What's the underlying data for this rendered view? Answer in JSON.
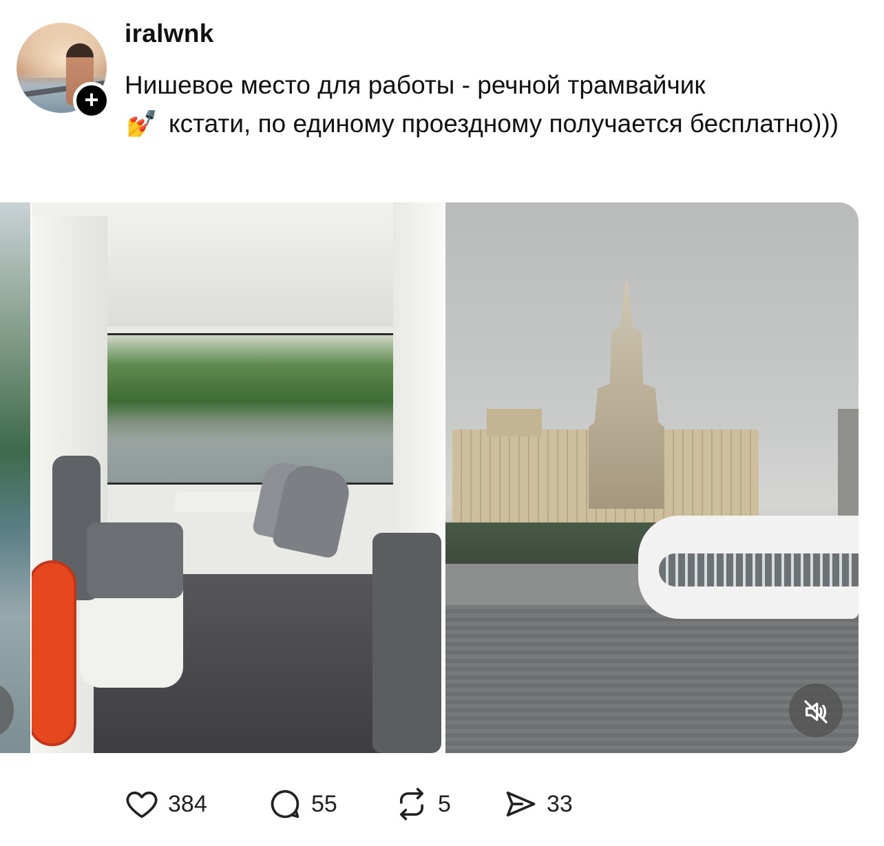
{
  "post": {
    "username": "iralwnk",
    "follow_symbol": "+",
    "text_part1": "Нишевое место для работы - речной трамвайчик",
    "emoji": "💅",
    "text_part2": "кстати, по единому проездному получается бесплатно)))"
  },
  "media": {
    "count_visible": 3,
    "current_has_video": true
  },
  "actions": {
    "likes": "384",
    "comments": "55",
    "reposts": "5",
    "shares": "33"
  },
  "icons": {
    "like": "heart-icon",
    "comment": "comment-bubble-icon",
    "repost": "repost-icon",
    "share": "send-icon",
    "mute": "muted-speaker-icon"
  }
}
